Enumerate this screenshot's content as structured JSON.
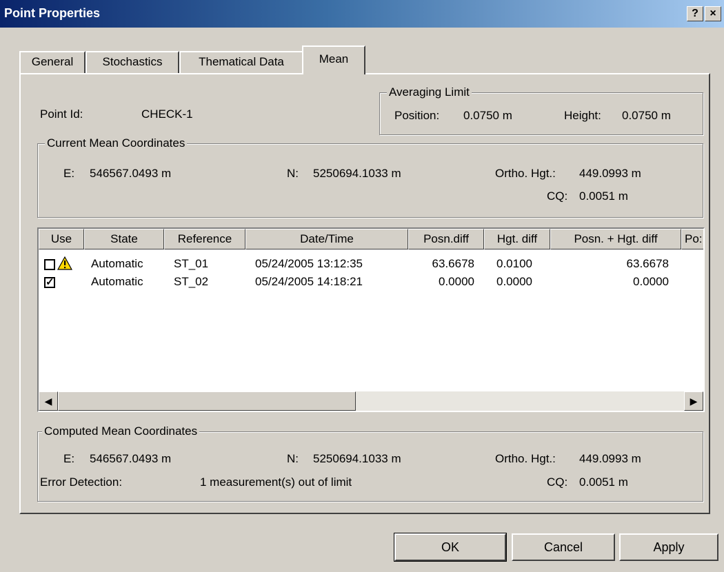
{
  "window": {
    "title": "Point Properties",
    "help_label": "?",
    "close_label": "×"
  },
  "tabs": [
    "General",
    "Stochastics",
    "Thematical Data",
    "Mean"
  ],
  "point": {
    "label": "Point Id:",
    "value": "CHECK-1"
  },
  "averaging_limit": {
    "legend": "Averaging Limit",
    "position_label": "Position:",
    "position_value": "0.0750 m",
    "height_label": "Height:",
    "height_value": "0.0750 m"
  },
  "current_mean": {
    "legend": "Current Mean Coordinates",
    "e_label": "E:",
    "e_value": "546567.0493 m",
    "n_label": "N:",
    "n_value": "5250694.1033 m",
    "ortho_label": "Ortho. Hgt.:",
    "ortho_value": "449.0993 m",
    "cq_label": "CQ:",
    "cq_value": "0.0051 m"
  },
  "table": {
    "columns": [
      "Use",
      "State",
      "Reference",
      "Date/Time",
      "Posn.diff",
      "Hgt. diff",
      "Posn. + Hgt. diff",
      "Po:"
    ],
    "rows": [
      {
        "checked": false,
        "warning": true,
        "state": "Automatic",
        "reference": "ST_01",
        "datetime": "05/24/2005 13:12:35",
        "posn_diff": "63.6678",
        "hgt_diff": "0.0100",
        "posn_hgt_diff": "63.6678"
      },
      {
        "checked": true,
        "warning": false,
        "state": "Automatic",
        "reference": "ST_02",
        "datetime": "05/24/2005 14:18:21",
        "posn_diff": "0.0000",
        "hgt_diff": "0.0000",
        "posn_hgt_diff": "0.0000"
      }
    ]
  },
  "computed_mean": {
    "legend": "Computed Mean Coordinates",
    "e_label": "E:",
    "e_value": "546567.0493 m",
    "n_label": "N:",
    "n_value": "5250694.1033 m",
    "ortho_label": "Ortho. Hgt.:",
    "ortho_value": "449.0993 m",
    "error_label": "Error Detection:",
    "error_value": "1 measurement(s) out of limit",
    "cq_label": "CQ:",
    "cq_value": "0.0051 m"
  },
  "buttons": {
    "ok": "OK",
    "cancel": "Cancel",
    "apply": "Apply"
  },
  "icons": {
    "warning": "warning-icon",
    "check": "check-icon",
    "scroll_left": "arrow-left-icon",
    "scroll_right": "arrow-right-icon"
  },
  "colors": {
    "titlebar_start": "#0a246a",
    "titlebar_end": "#a6caf0",
    "face": "#d4d0c8",
    "warning": "#ffd800"
  }
}
